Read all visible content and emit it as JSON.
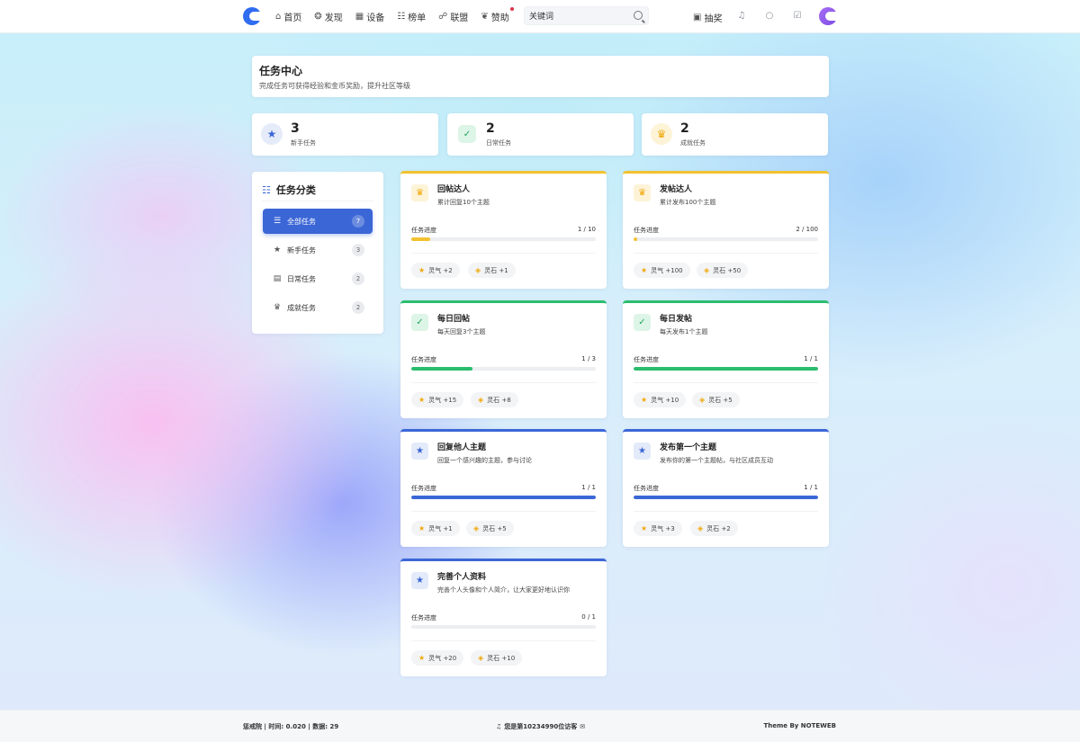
{
  "nav": {
    "items": [
      {
        "label": "首页",
        "icon": "home-icon",
        "glyph": "⌂"
      },
      {
        "label": "发现",
        "icon": "discover-icon",
        "glyph": "❂"
      },
      {
        "label": "设备",
        "icon": "devices-icon",
        "glyph": "▦"
      },
      {
        "label": "榜单",
        "icon": "ranking-icon",
        "glyph": "☷"
      },
      {
        "label": "联盟",
        "icon": "alliance-icon",
        "glyph": "☍"
      },
      {
        "label": "赞助",
        "icon": "sponsor-icon",
        "glyph": "❦"
      }
    ],
    "search_value": "关键词",
    "search_placeholder": "关键词",
    "lottery_label": "抽奖",
    "brand_color": "#2f6cf0"
  },
  "header": {
    "title": "任务中心",
    "subtitle": "完成任务可获得经验和金币奖励，提升社区等级"
  },
  "stats": [
    {
      "count": "3",
      "label": "新手任务",
      "icon": "star-icon",
      "glyph": "★",
      "color": "#3b66d6",
      "bg": "#e5ebf9"
    },
    {
      "count": "2",
      "label": "日常任务",
      "icon": "calendar-check-icon",
      "glyph": "✓",
      "color": "#22a45d",
      "bg": "#ddf5e7"
    },
    {
      "count": "2",
      "label": "成就任务",
      "icon": "trophy-icon",
      "glyph": "♛",
      "color": "#f0a90c",
      "bg": "#fdf3d7"
    }
  ],
  "sidebar": {
    "title": "任务分类",
    "items": [
      {
        "label": "全部任务",
        "count": "7",
        "icon": "list-icon",
        "glyph": "☰"
      },
      {
        "label": "新手任务",
        "count": "3",
        "icon": "star-icon",
        "glyph": "★"
      },
      {
        "label": "日常任务",
        "count": "2",
        "icon": "calendar-icon",
        "glyph": "▤"
      },
      {
        "label": "成就任务",
        "count": "2",
        "icon": "trophy-icon",
        "glyph": "♛"
      }
    ]
  },
  "tasks": [
    {
      "title": "回帖达人",
      "desc": "累计回复10个主题",
      "progress_label": "任务进度",
      "progress_text": "1 / 10",
      "progress": 0.1,
      "type": "achievement",
      "reward_qi": "灵气 +2",
      "reward_stone": "灵石 +1"
    },
    {
      "title": "发帖达人",
      "desc": "累计发布100个主题",
      "progress_label": "任务进度",
      "progress_text": "2 / 100",
      "progress": 0.02,
      "type": "achievement",
      "reward_qi": "灵气 +100",
      "reward_stone": "灵石 +50"
    },
    {
      "title": "每日回帖",
      "desc": "每天回复3个主题",
      "progress_label": "任务进度",
      "progress_text": "1 / 3",
      "progress": 0.3333,
      "type": "daily",
      "reward_qi": "灵气 +15",
      "reward_stone": "灵石 +8"
    },
    {
      "title": "每日发帖",
      "desc": "每天发布1个主题",
      "progress_label": "任务进度",
      "progress_text": "1 / 1",
      "progress": 1,
      "type": "daily",
      "reward_qi": "灵气 +10",
      "reward_stone": "灵石 +5"
    },
    {
      "title": "回复他人主题",
      "desc": "回复一个感兴趣的主题，参与讨论",
      "progress_label": "任务进度",
      "progress_text": "1 / 1",
      "progress": 1,
      "type": "novice",
      "reward_qi": "灵气 +1",
      "reward_stone": "灵石 +5"
    },
    {
      "title": "发布第一个主题",
      "desc": "发布你的第一个主题帖，与社区成员互动",
      "progress_label": "任务进度",
      "progress_text": "1 / 1",
      "progress": 1,
      "type": "novice",
      "reward_qi": "灵气 +3",
      "reward_stone": "灵石 +2"
    },
    {
      "title": "完善个人资料",
      "desc": "完善个人头像和个人简介，让大家更好地认识你",
      "progress_label": "任务进度",
      "progress_text": "0 / 1",
      "progress": 0,
      "type": "novice",
      "reward_qi": "灵气 +20",
      "reward_stone": "灵石 +10"
    }
  ],
  "footer": {
    "left": "惩戒院 | 时间: 0.020 | 数据: 29",
    "mid": "您是第10234990位访客",
    "right": "Theme By NOTEWEB"
  }
}
